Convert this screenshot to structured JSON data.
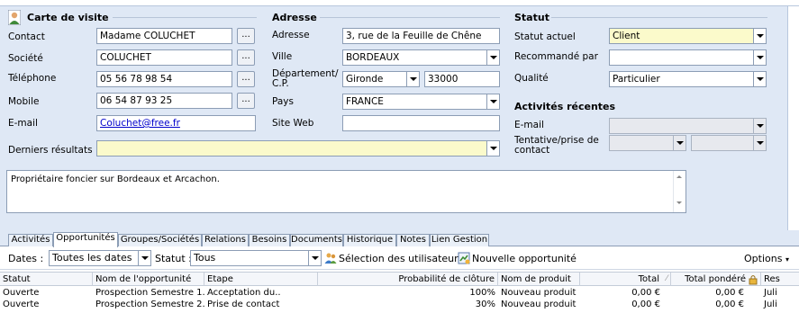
{
  "contact_card": {
    "title": "Carte de visite",
    "contact_label": "Contact",
    "contact_value": "Madame COLUCHET",
    "societe_label": "Société",
    "societe_value": "COLUCHET",
    "telephone_label": "Téléphone",
    "telephone_value": "05 56 78 98 54",
    "mobile_label": "Mobile",
    "mobile_value": "06 54 87 93 25",
    "email_label": "E-mail",
    "email_value": "Coluchet@free.fr",
    "ellipsis": "...",
    "derniers_label": "Derniers résultats",
    "derniers_value": ""
  },
  "address": {
    "title": "Adresse",
    "adresse_label": "Adresse",
    "adresse_value": "3, rue de la Feuille de Chêne",
    "ville_label": "Ville",
    "ville_value": "BORDEAUX",
    "dept_label_1": "Département/",
    "dept_label_2": "C.P.",
    "dept_value": "Gironde",
    "cp_value": "33000",
    "pays_label": "Pays",
    "pays_value": "FRANCE",
    "site_label": "Site Web",
    "site_value": ""
  },
  "status": {
    "title": "Statut",
    "statut_label": "Statut actuel",
    "statut_value": "Client",
    "recommande_label": "Recommandé par",
    "recommande_value": "",
    "qualite_label": "Qualité",
    "qualite_value": "Particulier"
  },
  "recent": {
    "title": "Activités récentes",
    "email_label": "E-mail",
    "tentative_label_1": "Tentative/prise de",
    "tentative_label_2": "contact"
  },
  "notes": {
    "text": "Propriétaire foncier sur Bordeaux et Arcachon."
  },
  "tabs": [
    {
      "label": "Activités"
    },
    {
      "label": "Opportunités"
    },
    {
      "label": "Groupes/Sociétés"
    },
    {
      "label": "Relations"
    },
    {
      "label": "Besoins"
    },
    {
      "label": "Documents"
    },
    {
      "label": "Historique"
    },
    {
      "label": "Notes"
    },
    {
      "label": "Lien Gestion"
    }
  ],
  "toolbar": {
    "dates_label": "Dates :",
    "dates_value": "Toutes les dates",
    "statut_label": "Statut :",
    "statut_value": "Tous",
    "select_users": "Sélection des utilisateurs",
    "new_opportunity": "Nouvelle opportunité",
    "options": "Options"
  },
  "grid": {
    "headers": [
      "Statut",
      "Nom de l'opportunité",
      "Etape",
      "Probabilité de clôture",
      "Nom de produit",
      "Total",
      "Total pondéré",
      "Res"
    ],
    "rows": [
      [
        "Ouverte",
        "Prospection Semestre 1..",
        "Acceptation du..",
        "100%",
        "Nouveau produit",
        "0,00 €",
        "0,00 €",
        "Juli"
      ],
      [
        "Ouverte",
        "Prospection Semestre 2..",
        "Prise de contact",
        "30%",
        "Nouveau produit",
        "0,00 €",
        "0,00 €",
        "Juli"
      ]
    ]
  },
  "colors": {
    "form_bg": "#dfe8f5",
    "highlight_field": "#fbfacb",
    "link": "#0000cc"
  }
}
